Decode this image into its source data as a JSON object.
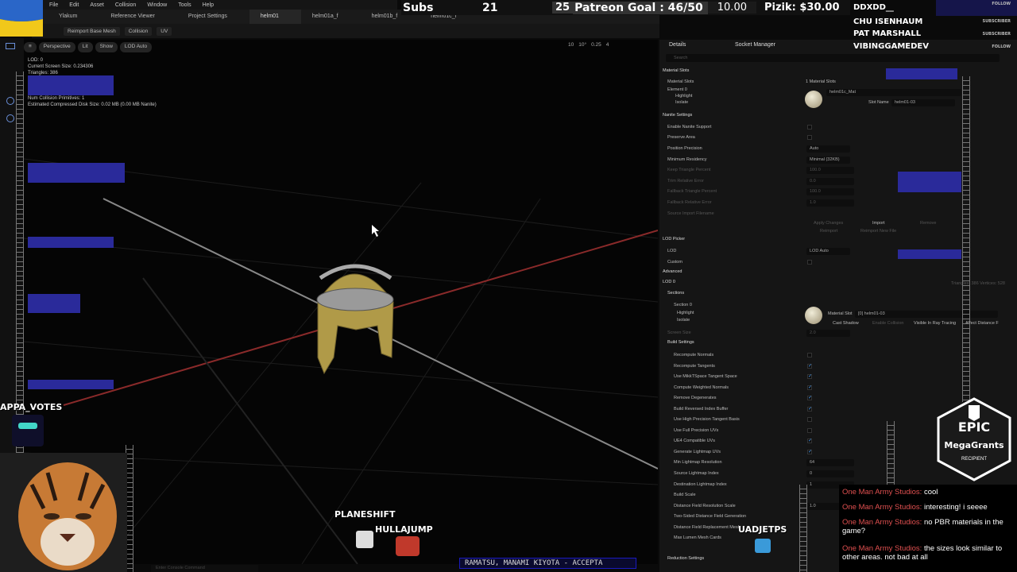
{
  "menu": [
    "File",
    "Edit",
    "Asset",
    "Collision",
    "Window",
    "Tools",
    "Help"
  ],
  "tabs": [
    {
      "label": "Ylakum"
    },
    {
      "label": "Reference Viewer"
    },
    {
      "label": "Project Settings"
    },
    {
      "label": "helm01",
      "active": true
    },
    {
      "label": "helm01a_f"
    },
    {
      "label": "helm01b_f"
    },
    {
      "label": "helm01c_f"
    }
  ],
  "toolbar": {
    "reimport": "Reimport Base Mesh",
    "collision": "Collision",
    "uv": "UV"
  },
  "viewport_toolbar": {
    "perspective": "Perspective",
    "lit": "Lit",
    "show": "Show",
    "lod": "LOD Auto",
    "right_vals": [
      "10",
      "10°",
      "0.25",
      "4"
    ]
  },
  "stats": [
    "LOD: 0",
    "Current Screen Size: 0.234306",
    "Triangles: 386",
    "Vertices: 528",
    "UV Channels: 2",
    "Approx Size: 23x23x31",
    "Num Collision Primitives: 1",
    "Estimated Compressed Disk Size: 0.02 MB (0.00 MB Nanite)"
  ],
  "details": {
    "tab_details": "Details",
    "tab_socket": "Socket Manager",
    "search_placeholder": "Search",
    "material_slots_header": "Material Slots",
    "material_slots_label": "Material Slots",
    "material_slots_count": "1 Material Slots",
    "element": "Element 0",
    "highlight": "Highlight",
    "isolate": "Isolate",
    "material_name": "helm01c_Mat",
    "slot_name_label": "Slot Name",
    "slot_name_value": "helm01-03",
    "nanite_header": "Nanite Settings",
    "enable_nanite": "Enable Nanite Support",
    "preserve_area": "Preserve Area",
    "position_precision": "Position Precision",
    "position_precision_val": "Auto",
    "min_residency": "Minimum Residency",
    "min_residency_val": "Minimal (32KB)",
    "keep_triangle": "Keep Triangle Percent",
    "keep_triangle_val": "100.0",
    "trim_error": "Trim Relative Error",
    "trim_error_val": "0.0",
    "fallback_triangle": "Fallback Triangle Percent",
    "fallback_triangle_val": "100.0",
    "fallback_error": "Fallback Relative Error",
    "fallback_error_val": "1.0",
    "source_import": "Source Import Filename",
    "apply_changes": "Apply Changes",
    "import": "Import",
    "remove": "Remove",
    "reimport": "Reimport",
    "reimport_new": "Reimport New File",
    "lod_picker_header": "LOD Picker",
    "lod": "LOD",
    "lod_val": "LOD Auto",
    "custom": "Custom",
    "advanced": "Advanced",
    "lod0_header": "LOD 0",
    "lod0_info": "Triangles: 386    Vertices: 528",
    "sections_header": "Sections",
    "section0": "Section 0",
    "material_slot": "Material Slot",
    "material_slot_val": "[0] helm01-03",
    "cast_shadow": "Cast Shadow",
    "enable_collision": "Enable Collision",
    "visible_ray": "Visible In Ray Tracing",
    "affect_distance": "Affect Distance F",
    "screen_size": "Screen Size",
    "screen_size_val": "2.0",
    "build_header": "Build Settings",
    "build_rows": [
      {
        "label": "Recompute Normals",
        "checked": false
      },
      {
        "label": "Recompute Tangents",
        "checked": true
      },
      {
        "label": "Use MikkTSpace Tangent Space",
        "checked": true
      },
      {
        "label": "Compute Weighted Normals",
        "checked": true
      },
      {
        "label": "Remove Degenerates",
        "checked": true
      },
      {
        "label": "Build Reversed Index Buffer",
        "checked": true
      },
      {
        "label": "Use High Precision Tangent Basis",
        "checked": false
      },
      {
        "label": "Use Full Precision UVs",
        "checked": false
      },
      {
        "label": "UE4 Compatible UVs",
        "checked": true
      },
      {
        "label": "Generate Lightmap UVs",
        "checked": true
      }
    ],
    "min_lightmap": "Min Lightmap Resolution",
    "min_lightmap_val": "64",
    "src_lightmap": "Source Lightmap Index",
    "src_lightmap_val": "0",
    "dst_lightmap": "Destination Lightmap Index",
    "dst_lightmap_val": "1",
    "build_scale": "Build Scale",
    "df_res": "Distance Field Resolution Scale",
    "df_res_val": "1.0",
    "two_sided_df": "Two-Sided Distance Field Generation",
    "df_replacement": "Distance Field Replacement Mesh",
    "max_lumen": "Max Lumen Mesh Cards",
    "reduction": "Reduction Settings"
  },
  "stream_top": {
    "subs_label": "Subs",
    "subs_value": "21",
    "patreon_num": "25",
    "patreon_goal": "Patreon Goal : 46/50",
    "amount": "10.00",
    "pizik": "Pizik: $30.00"
  },
  "events": [
    {
      "name": "DDXDD__",
      "tag": "FOLLOW"
    },
    {
      "name": "CHU ISENHAUM",
      "tag": "SUBSCRIBER"
    },
    {
      "name": "PAT MARSHALL",
      "tag": "SUBSCRIBER"
    },
    {
      "name": "VIBINGGAMEDEV",
      "tag": "FOLLOW"
    }
  ],
  "epic": {
    "title": "EPIC",
    "subtitle": "MegaGrants",
    "badge": "RECIPIENT"
  },
  "chat": [
    {
      "user": "One Man Army Studios:",
      "text": "cool"
    },
    {
      "user": "One Man Army Studios:",
      "text": "interesting! i seeee"
    },
    {
      "user": "One Man Army Studios:",
      "text": "no PBR materials in the game?"
    },
    {
      "user": "One Man Army Studios:",
      "text": "the sizes look similar to other areas. not bad at all"
    }
  ],
  "players": {
    "p1": "APPA_VOTES",
    "p2": "PLANESHIFT",
    "p3": "HULLAJUMP",
    "p4": "UADJETPS"
  },
  "ticker": "RAMATSU, MANAMI KIYOTA - ACCEPTA",
  "console_placeholder": "Enter Console Command",
  "colors": {
    "accent": "#4aa3ff",
    "platform": "#2a2a9a",
    "chat_user": "#e05050"
  }
}
